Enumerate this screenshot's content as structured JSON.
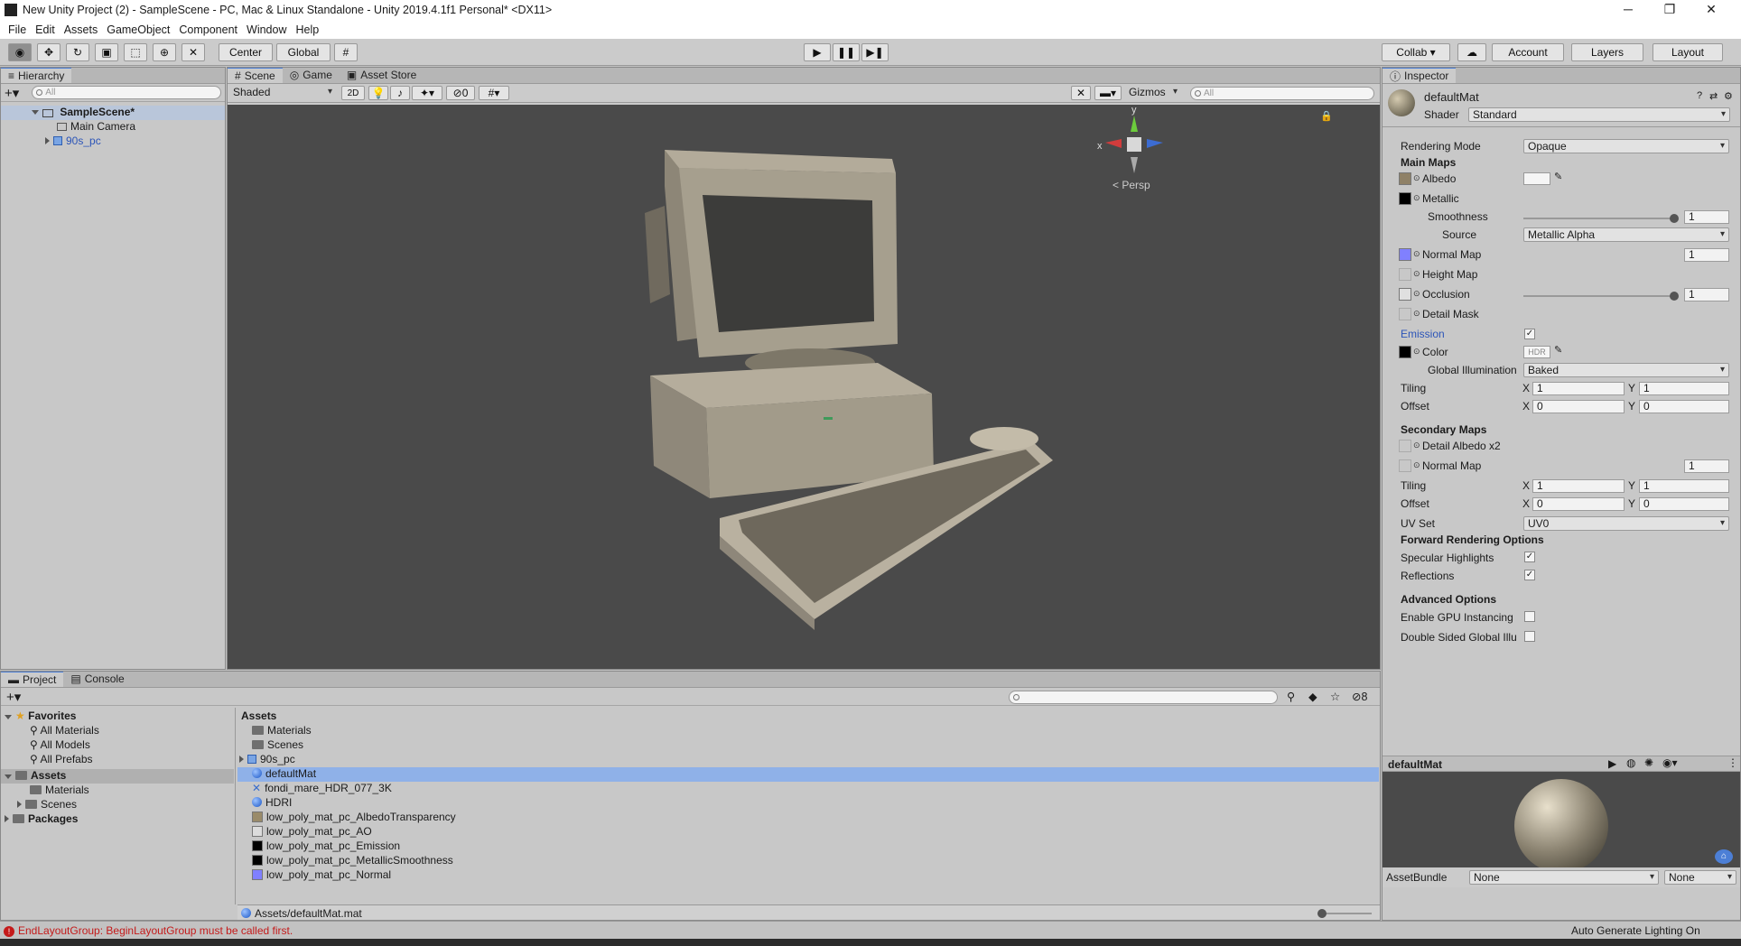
{
  "window": {
    "title": "New Unity Project (2) - SampleScene - PC, Mac & Linux Standalone - Unity 2019.4.1f1 Personal* <DX11>",
    "min": "─",
    "max": "❐",
    "close": "✕"
  },
  "menu": [
    "File",
    "Edit",
    "Assets",
    "GameObject",
    "Component",
    "Window",
    "Help"
  ],
  "toolbar": {
    "center": "Center",
    "global": "Global",
    "collab": "Collab ▾",
    "account": "Account",
    "layers": "Layers",
    "layout": "Layout"
  },
  "hierarchy": {
    "tab": "Hierarchy",
    "search": "All",
    "scene": "SampleScene*",
    "items": [
      "Main Camera",
      "90s_pc"
    ]
  },
  "scene": {
    "tabs": [
      "Scene",
      "Game",
      "Asset Store"
    ],
    "shading": "Shaded",
    "mode2d": "2D",
    "hidden_count": "0",
    "gizmos": "Gizmos",
    "search": "All",
    "persp": "< Persp",
    "axis_x": "x",
    "axis_y": "y"
  },
  "inspector": {
    "tab": "Inspector",
    "material": "defaultMat",
    "shader_label": "Shader",
    "shader": "Standard",
    "rendering_mode_label": "Rendering Mode",
    "rendering_mode": "Opaque",
    "main_maps": "Main Maps",
    "albedo": "Albedo",
    "metallic": "Metallic",
    "smoothness": "Smoothness",
    "smoothness_value": "1",
    "source_label": "Source",
    "source": "Metallic Alpha",
    "normal_map": "Normal Map",
    "normal_value": "1",
    "height_map": "Height Map",
    "occlusion": "Occlusion",
    "occlusion_value": "1",
    "detail_mask": "Detail Mask",
    "emission": "Emission",
    "color": "Color",
    "hdr": "HDR",
    "gi_label": "Global Illumination",
    "gi": "Baked",
    "tiling": "Tiling",
    "offset": "Offset",
    "x": "X",
    "y": "Y",
    "main_tiling": [
      "1",
      "1"
    ],
    "main_offset": [
      "0",
      "0"
    ],
    "secondary_maps": "Secondary Maps",
    "detail_albedo": "Detail Albedo x2",
    "sec_normal": "Normal Map",
    "sec_normal_value": "1",
    "sec_tiling": [
      "1",
      "1"
    ],
    "sec_offset": [
      "0",
      "0"
    ],
    "uvset_label": "UV Set",
    "uvset": "UV0",
    "forward": "Forward Rendering Options",
    "specular": "Specular Highlights",
    "reflections": "Reflections",
    "advanced": "Advanced Options",
    "gpu_instancing": "Enable GPU Instancing",
    "double_sided": "Double Sided Global Illu",
    "preview_title": "defaultMat",
    "assetbundle_label": "AssetBundle",
    "assetbundle": "None",
    "variant": "None"
  },
  "project": {
    "tabs": [
      "Project",
      "Console"
    ],
    "hidden_count": "8",
    "favorites": "Favorites",
    "fav_items": [
      "All Materials",
      "All Models",
      "All Prefabs"
    ],
    "assets_root": "Assets",
    "assets_children": [
      "Materials",
      "Scenes"
    ],
    "packages": "Packages",
    "breadcrumb": "Assets",
    "files": [
      "Materials",
      "Scenes",
      "90s_pc",
      "defaultMat",
      "fondi_mare_HDR_077_3K",
      "HDRI",
      "low_poly_mat_pc_AlbedoTransparency",
      "low_poly_mat_pc_AO",
      "low_poly_mat_pc_Emission",
      "low_poly_mat_pc_MetallicSmoothness",
      "low_poly_mat_pc_Normal"
    ],
    "path": "Assets/defaultMat.mat"
  },
  "status": {
    "error": "EndLayoutGroup: BeginLayoutGroup must be called first.",
    "lighting": "Auto Generate Lighting On"
  },
  "colors": {
    "accent": "#4c7fd6",
    "selection": "#8fb1e8",
    "error": "#c41a1a",
    "scene_bg": "#4a4a4a"
  }
}
